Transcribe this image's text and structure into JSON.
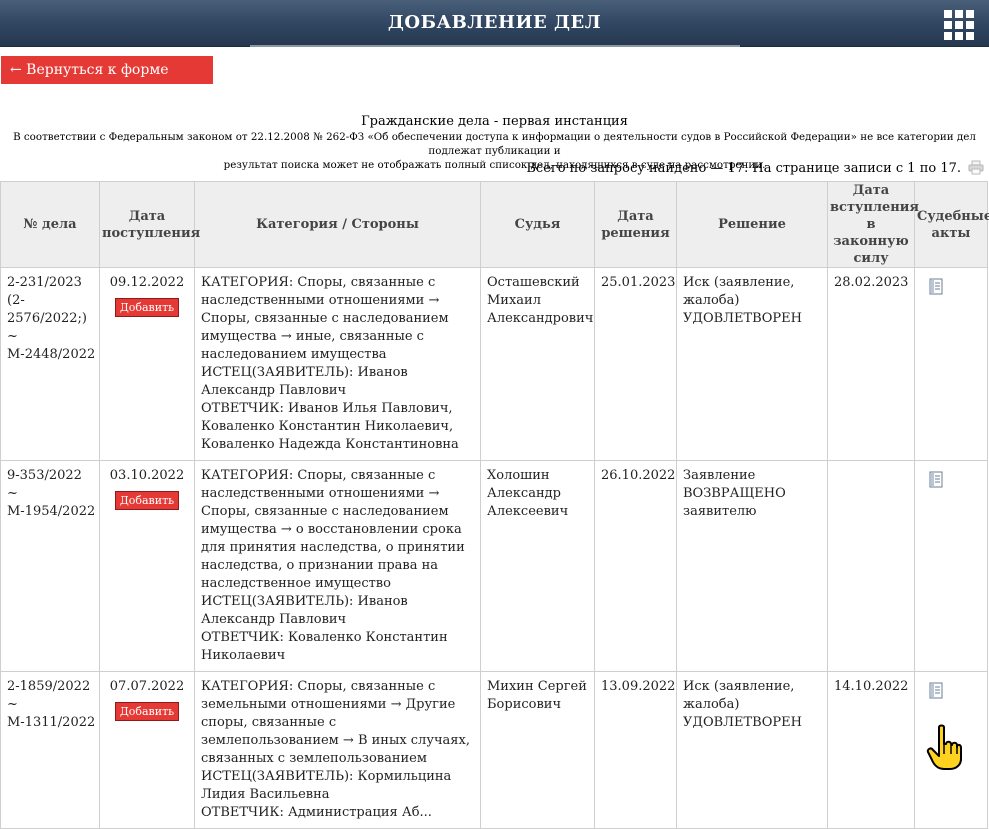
{
  "header": {
    "title": "ДОБАВЛЕНИЕ ДЕЛ",
    "menu_icon": "grid-menu-icon"
  },
  "back_button": {
    "label": "← Вернуться к форме поиска"
  },
  "section": {
    "title": "Гражданские дела - первая инстанция",
    "notice_line1": "В соответствии с Федеральным законом от 22.12.2008 № 262-ФЗ «Об обеспечении доступа к информации о деятельности судов в Российской Федерации» не все категории дел подлежат публикации и",
    "notice_line2": "результат поиска может не отображать полный список дел, находящихся в суде на рассмотрении.",
    "total": "Всего по запросу найдено — 17. На странице записи с 1 по 17."
  },
  "table": {
    "headers": {
      "num": "№ дела",
      "date_in": "Дата поступления",
      "category": "Категория / Стороны",
      "judge": "Судья",
      "date_dec": "Дата решения",
      "decision": "Решение",
      "date_law": "Дата вступления в законную силу",
      "acts": "Судебные акты"
    },
    "add_label": "Добавить",
    "rows": [
      {
        "num_lines": [
          "2-231/2023",
          "(2-",
          "2576/2022;)",
          "~",
          "М-2448/2022"
        ],
        "date_in": "09.12.2022",
        "category_lines": [
          "КАТЕГОРИЯ: Споры, связанные с",
          "наследственными отношениями →",
          "Споры, связанные с наследованием",
          "имущества → иные, связанные с",
          "наследованием имущества",
          "ИСТЕЦ(ЗАЯВИТЕЛЬ): Иванов",
          "Александр Павлович",
          "ОТВЕТЧИК: Иванов Илья Павлович,",
          "Коваленко Константин Николаевич,",
          "Коваленко Надежда Константиновна"
        ],
        "judge_lines": [
          "Осташевский",
          "Михаил",
          "Александрович"
        ],
        "date_dec": "25.01.2023",
        "decision_lines": [
          "Иск (заявление,",
          "жалоба)",
          "УДОВЛЕТВОРЕН"
        ],
        "date_law": "28.02.2023"
      },
      {
        "num_lines": [
          "9-353/2022 ~",
          "М-1954/2022"
        ],
        "date_in": "03.10.2022",
        "category_lines": [
          "КАТЕГОРИЯ: Споры, связанные с",
          "наследственными отношениями →",
          "Споры, связанные с наследованием",
          "имущества → о восстановлении срока",
          "для принятия наследства, о принятии",
          "наследства, о признании права на",
          "наследственное имущество",
          "ИСТЕЦ(ЗАЯВИТЕЛЬ): Иванов",
          "Александр Павлович",
          "ОТВЕТЧИК: Коваленко Константин",
          "Николаевич"
        ],
        "judge_lines": [
          "Холошин",
          "Александр",
          "Алексеевич"
        ],
        "date_dec": "26.10.2022",
        "decision_lines": [
          "Заявление",
          "ВОЗВРАЩЕНО",
          "заявителю"
        ],
        "date_law": ""
      },
      {
        "num_lines": [
          "2-1859/2022",
          "~",
          "М-1311/2022"
        ],
        "date_in": "07.07.2022",
        "category_lines": [
          "КАТЕГОРИЯ: Споры, связанные с",
          "земельными отношениями → Другие",
          "споры, связанные с",
          "землепользованием → В иных случаях,",
          "связанных с землепользованием",
          "ИСТЕЦ(ЗАЯВИТЕЛЬ): Кормильцина",
          "Лидия Васильевна",
          "ОТВЕТЧИК: Администрация Аб..."
        ],
        "judge_lines": [
          "Михин Сергей",
          "Борисович"
        ],
        "date_dec": "13.09.2022",
        "decision_lines": [
          "Иск (заявление,",
          "жалоба)",
          "УДОВЛЕТВОРЕН"
        ],
        "date_law": "14.10.2022"
      }
    ]
  },
  "icons": {
    "print": "print-icon",
    "act": "document-icon",
    "hand": "pointing-hand-icon"
  }
}
